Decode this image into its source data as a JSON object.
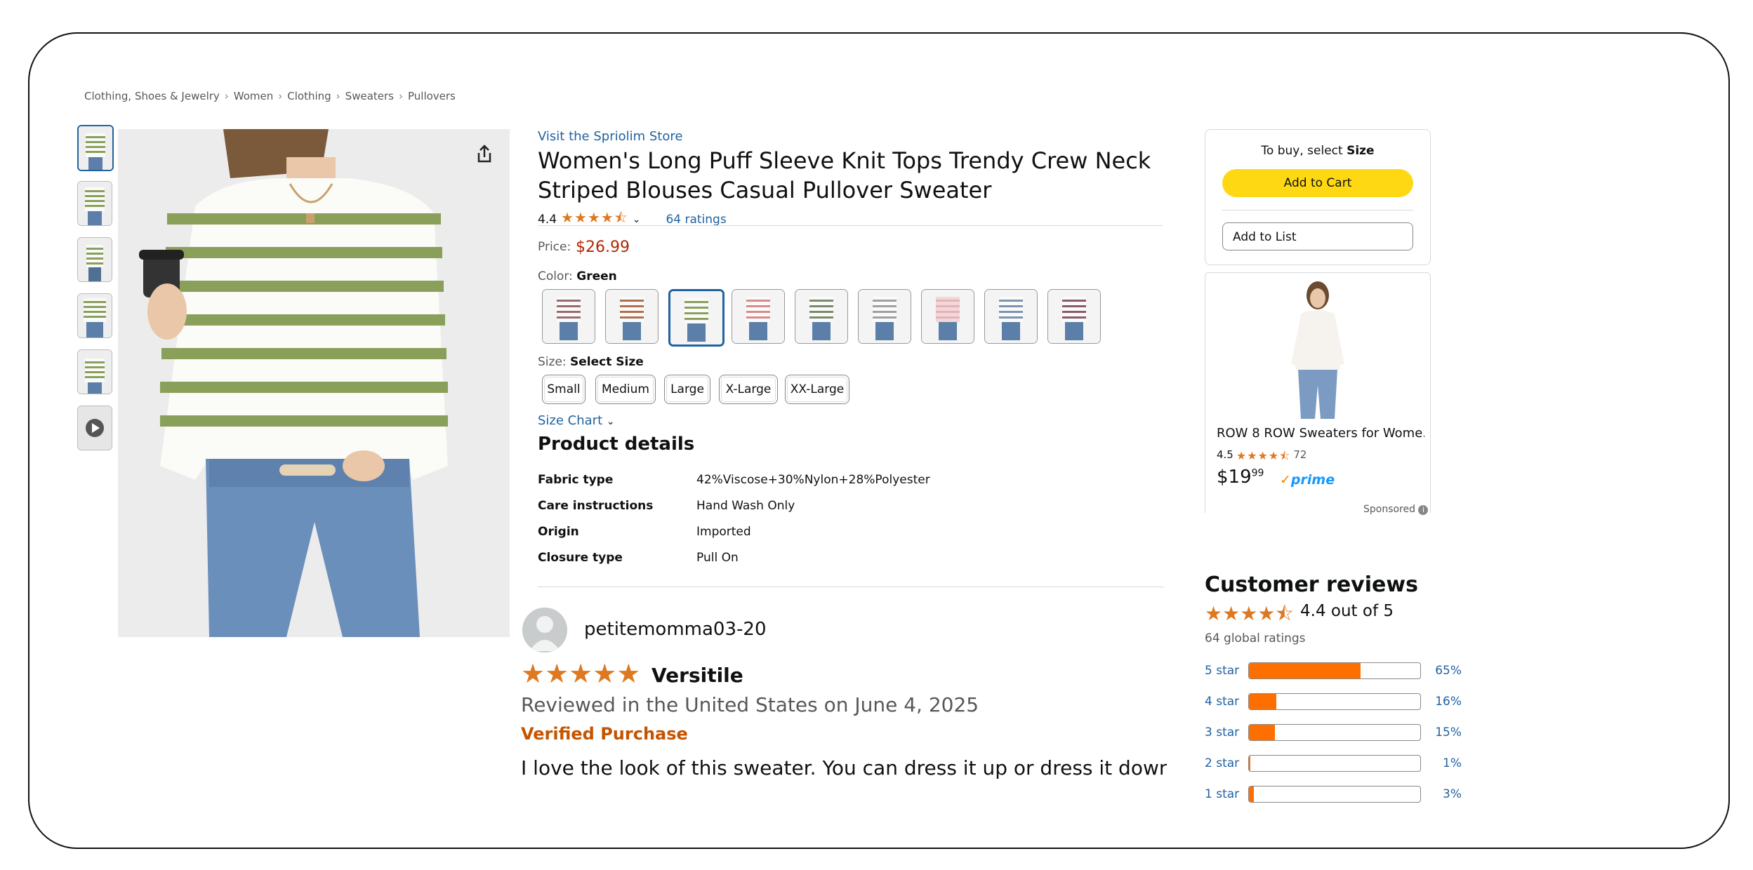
{
  "breadcrumb": [
    "Clothing, Shoes & Jewelry",
    "Women",
    "Clothing",
    "Sweaters",
    "Pullovers"
  ],
  "product": {
    "store_link": "Visit the Spriolim Store",
    "title_line1": "Women's Long Puff Sleeve Knit Tops Trendy Crew Neck",
    "title_line2": "Striped Blouses Casual Pullover Sweater",
    "rating_value": "4.4",
    "rating_count": "64 ratings",
    "price_label": "Price:",
    "price": "$26.99",
    "color_label": "Color:",
    "color_selected": "Green",
    "color_swatch_count": 9,
    "size_label": "Size:",
    "size_selected": "Select Size",
    "sizes": [
      "Small",
      "Medium",
      "Large",
      "X-Large",
      "XX-Large"
    ],
    "size_chart": "Size Chart"
  },
  "product_details": {
    "title": "Product details",
    "rows": [
      {
        "key": "Fabric type",
        "value": "42%Viscose+30%Nylon+28%Polyester"
      },
      {
        "key": "Care instructions",
        "value": "Hand Wash Only"
      },
      {
        "key": "Origin",
        "value": "Imported"
      },
      {
        "key": "Closure type",
        "value": "Pull On"
      }
    ]
  },
  "review": {
    "reviewer": "petitemomma03-20",
    "stars": 5,
    "title": "Versitile",
    "date": "Reviewed in the United States on June 4, 2025",
    "verified": "Verified Purchase",
    "text": "I love the look of this sweater. You can dress it up or dress it down"
  },
  "buy_box": {
    "to_buy_prefix": "To buy, select",
    "to_buy_bold": "Size",
    "add_to_cart": "Add to Cart",
    "add_to_list": "Add to List"
  },
  "sponsored_ad": {
    "title": "ROW 8 ROW Sweaters for Wome...",
    "rating": "4.5",
    "rating_count": "72",
    "price_whole": "$19",
    "price_fraction": "99",
    "prime": "prime",
    "sponsored_label": "Sponsored"
  },
  "customer_reviews": {
    "title": "Customer reviews",
    "average": "4.4 out of 5",
    "global_ratings": "64 global ratings",
    "histogram": [
      {
        "label": "5 star",
        "percent": 65,
        "percent_text": "65%"
      },
      {
        "label": "4 star",
        "percent": 16,
        "percent_text": "16%"
      },
      {
        "label": "3 star",
        "percent": 15,
        "percent_text": "15%"
      },
      {
        "label": "2 star",
        "percent": 1,
        "percent_text": "1%"
      },
      {
        "label": "1 star",
        "percent": 3,
        "percent_text": "3%"
      }
    ]
  },
  "colors": {
    "link": "#2162a1",
    "price": "#b12704",
    "star": "#de7921",
    "add_to_cart": "#ffd814",
    "histogram_fill": "#ff6f00",
    "stripe_green": "#8aa05a",
    "verified": "#c45500"
  },
  "icons": {
    "share": "share-icon",
    "chevron": "chevron-down-icon",
    "video": "play-icon",
    "info": "info-icon"
  }
}
